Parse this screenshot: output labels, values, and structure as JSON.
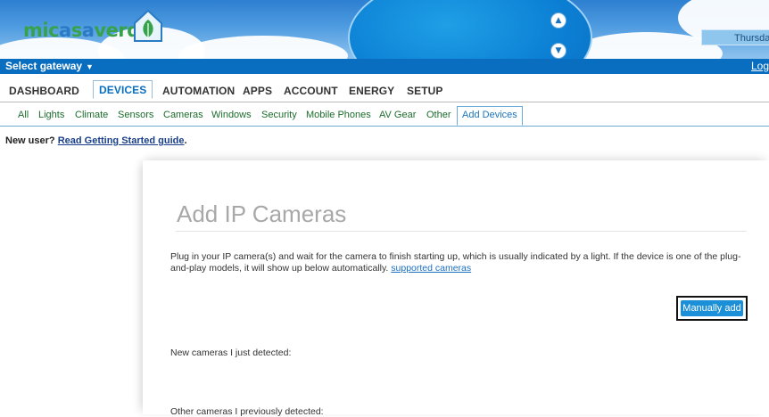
{
  "header": {
    "logo_part1": "mic",
    "logo_o1": "a",
    "logo_part2": "s",
    "logo_o2": "a",
    "logo_part3": "verde",
    "date_text": "Thursda",
    "colors": {
      "sky": "#2d7fd0",
      "logo_green": "#36a34a",
      "logo_blue": "#2b7bc4"
    }
  },
  "gateway_bar": {
    "select_label": "Select gateway",
    "logout_label": "Log",
    "color": "#0a6ec0"
  },
  "main_nav": {
    "tabs": [
      {
        "label": "DASHBOARD"
      },
      {
        "label": "DEVICES"
      },
      {
        "label": "AUTOMATION"
      },
      {
        "label": "APPS"
      },
      {
        "label": "ACCOUNT"
      },
      {
        "label": "ENERGY"
      },
      {
        "label": "SETUP"
      }
    ],
    "active": "DEVICES"
  },
  "sub_nav": {
    "items": [
      {
        "label": "All"
      },
      {
        "label": "Lights"
      },
      {
        "label": "Climate"
      },
      {
        "label": "Sensors"
      },
      {
        "label": "Cameras"
      },
      {
        "label": "Windows"
      },
      {
        "label": "Security"
      },
      {
        "label": "Mobile Phones"
      },
      {
        "label": "AV Gear"
      },
      {
        "label": "Other"
      },
      {
        "label": "Add Devices"
      }
    ],
    "active": "Add Devices"
  },
  "notice": {
    "prefix": "New user?",
    "link": "Read Getting Started guide",
    "suffix": "."
  },
  "panel": {
    "title": "Add IP Cameras",
    "intro_text": "Plug in your IP camera(s) and wait for the camera to finish starting up, which is usually indicated by a light. If the device is one of the plug-and-play models, it will show up below automatically.",
    "intro_link": "supported cameras",
    "manual_add_label": "Manually add",
    "new_cameras_label": "New cameras I just detected:",
    "other_cameras_label": "Other cameras I previously detected:"
  }
}
